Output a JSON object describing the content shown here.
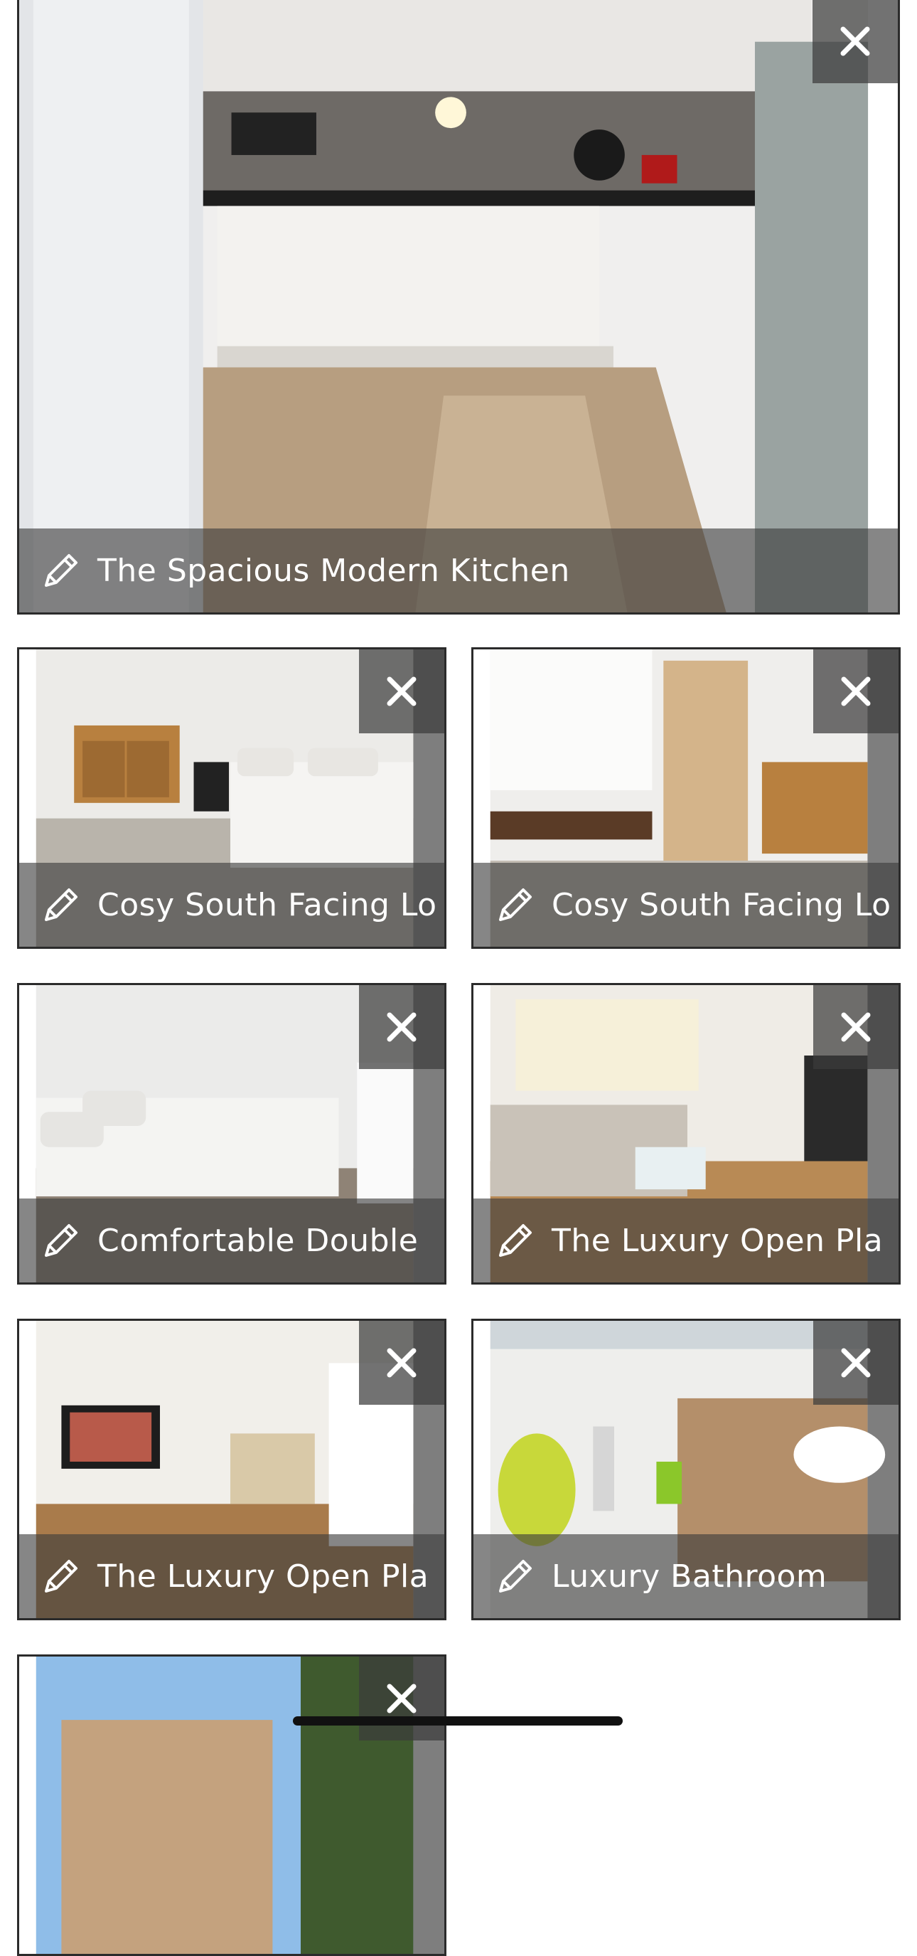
{
  "gallery": {
    "photos": [
      {
        "caption": "The Spacious Modern Kitchen",
        "scene": "kitchen"
      },
      {
        "caption": "Cosy South Facing Lo",
        "scene": "bedroom"
      },
      {
        "caption": "Cosy South Facing Lo",
        "scene": "bedroom-desk"
      },
      {
        "caption": "Comfortable Double",
        "scene": "double-bedroom"
      },
      {
        "caption": "The Luxury Open Pla",
        "scene": "living-room"
      },
      {
        "caption": "The Luxury Open Pla",
        "scene": "open-plan-tv"
      },
      {
        "caption": "Luxury Bathroom",
        "scene": "bathroom"
      },
      {
        "caption": "",
        "scene": "exterior"
      }
    ]
  },
  "icons": {
    "edit": "pencil-icon",
    "remove": "close-icon"
  },
  "colors": {
    "overlay": "#3c3c3c",
    "tile_border": "#2b2b2b",
    "caption_text": "#ffffff"
  }
}
